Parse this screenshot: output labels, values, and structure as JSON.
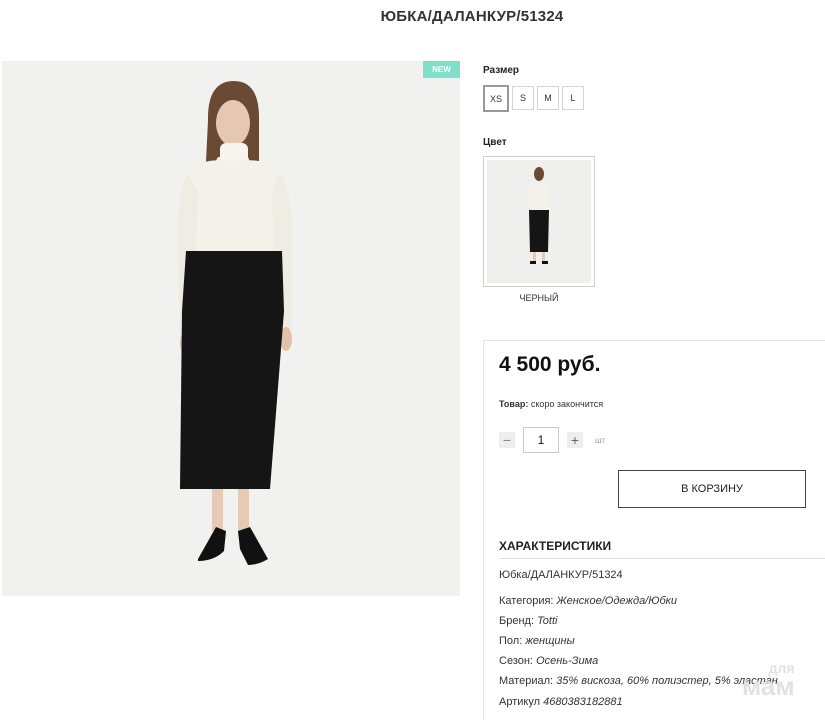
{
  "product": {
    "title": "ЮБКА/ДАЛАНКУР/51324",
    "badge": "NEW",
    "photo_alt": "model-photo"
  },
  "size": {
    "label": "Размер",
    "options": [
      "XS",
      "S",
      "M",
      "L"
    ],
    "selected": "XS"
  },
  "color": {
    "label": "Цвет",
    "selected_name": "ЧЕРНЫЙ"
  },
  "purchase": {
    "price": "4 500 руб.",
    "stock_label": "Товар:",
    "stock_value": "скоро закончится",
    "quantity": "1",
    "minus": "−",
    "plus": "+",
    "unit": "шт",
    "cart_button": "В КОРЗИНУ"
  },
  "specs": {
    "heading": "ХАРАКТЕРИСТИКИ",
    "sku_line": "Юбка/ДАЛАНКУР/51324",
    "rows": [
      {
        "key": "Категория:",
        "value": "Женское/Одежда/Юбки"
      },
      {
        "key": "Бренд:",
        "value": "Totti"
      },
      {
        "key": "Пол:",
        "value": "женщины"
      },
      {
        "key": "Сезон:",
        "value": "Осень-Зима"
      },
      {
        "key": "Материал:",
        "value": "35% вискоза, 60% полиэстер, 5% эластан"
      },
      {
        "key": "Артикул",
        "value": "4680383182881"
      }
    ]
  },
  "watermark": {
    "line1": "для",
    "line2": "мам"
  },
  "colors": {
    "badge": "#7ee0c9",
    "skirt": "#151515",
    "sweater": "#f3f1ea"
  }
}
